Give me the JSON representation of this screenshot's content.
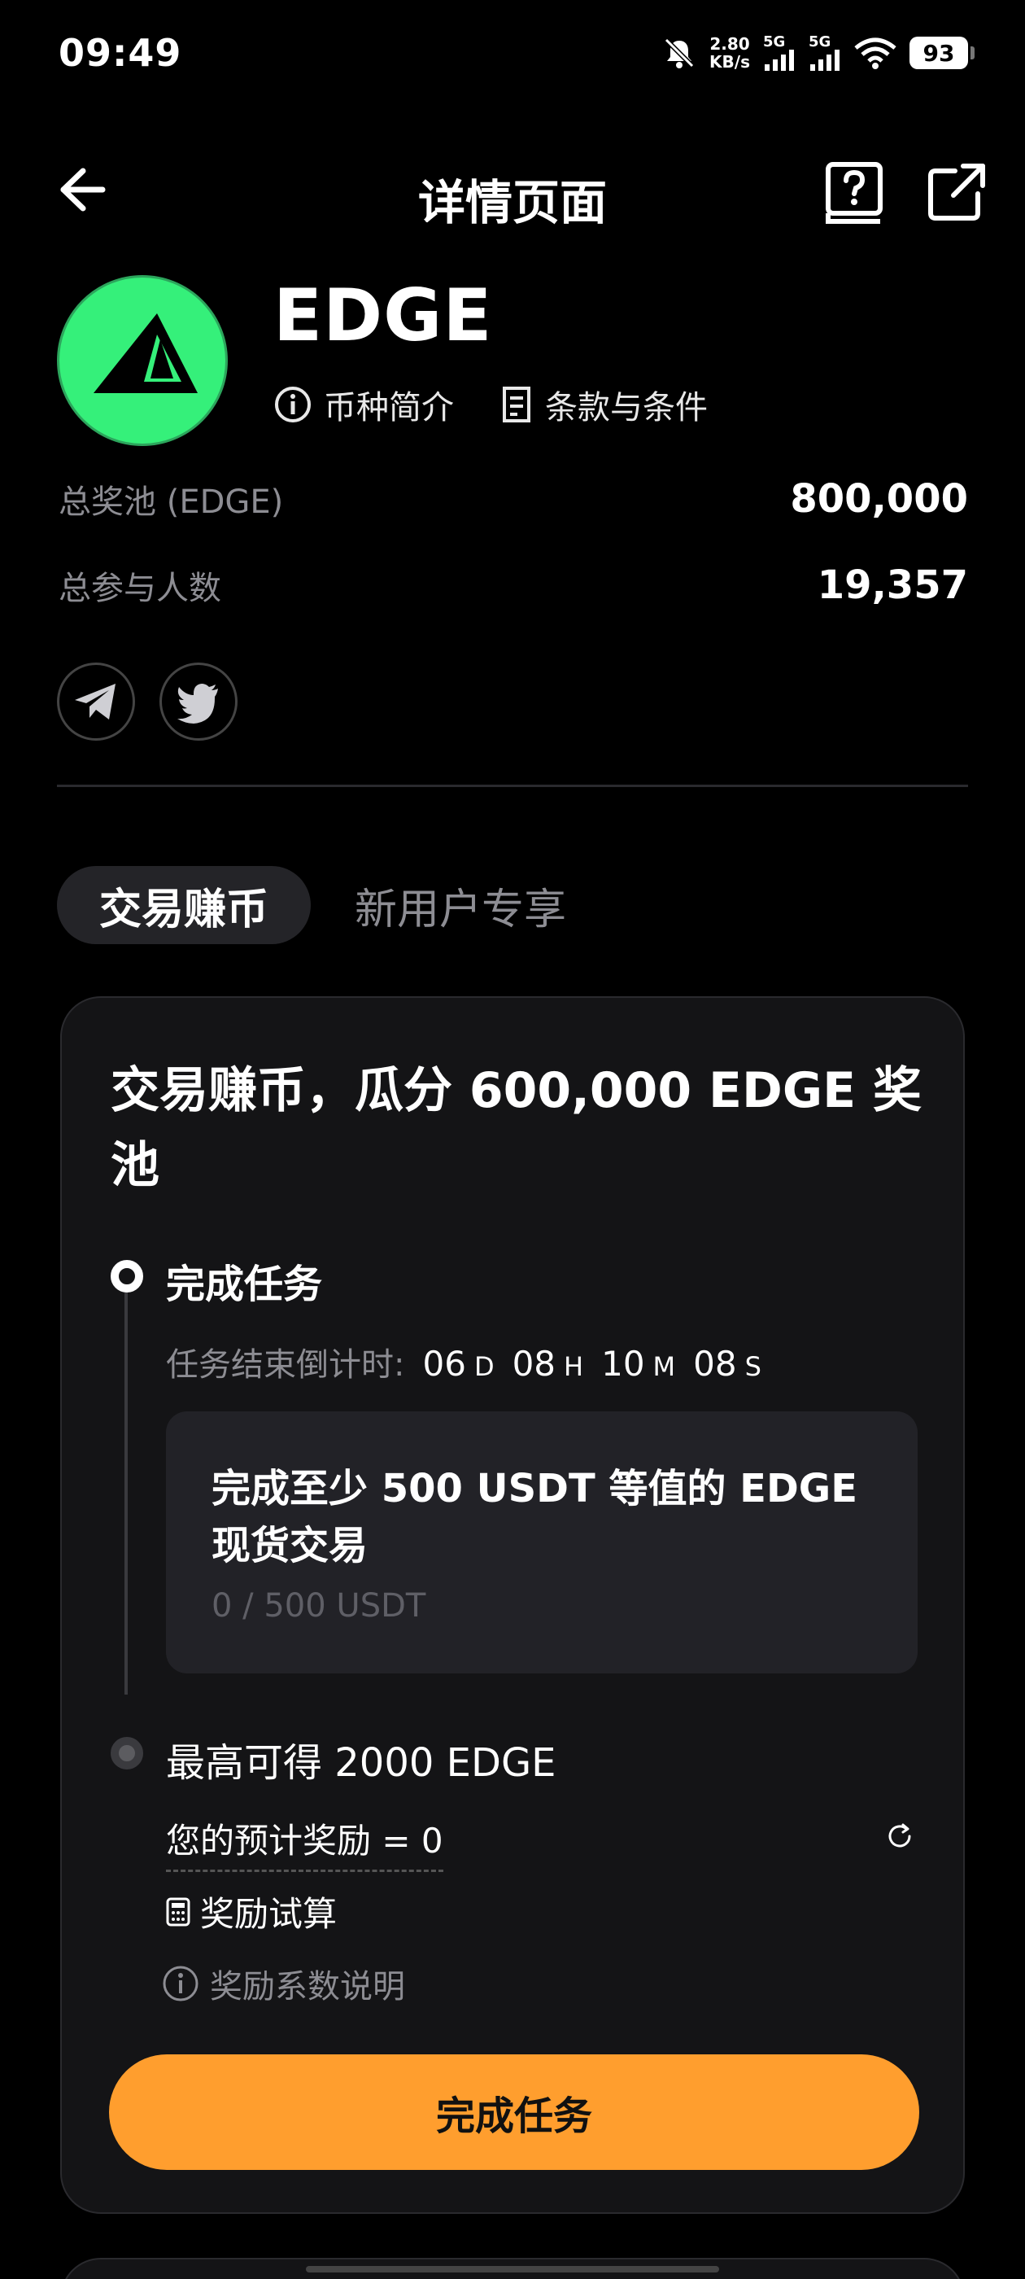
{
  "status_bar": {
    "time": "09:49",
    "net_speed_value": "2.80",
    "net_speed_unit": "KB/s",
    "sim1": "5G",
    "sim2": "5G",
    "battery": "93"
  },
  "nav": {
    "title": "详情页面",
    "back_icon": "arrow-left-icon",
    "help_icon": "help-book-icon",
    "share_icon": "external-link-icon"
  },
  "coin": {
    "name": "EDGE",
    "logo_color": "#35f07a",
    "link_intro": "币种简介",
    "link_terms": "条款与条件"
  },
  "stats": [
    {
      "label": "总奖池 (EDGE)",
      "value": "800,000"
    },
    {
      "label": "总参与人数",
      "value": "19,357"
    }
  ],
  "socials": [
    "telegram-icon",
    "twitter-icon"
  ],
  "tabs": {
    "active": "交易赚币",
    "inactive": "新用户专享"
  },
  "card": {
    "title": "交易赚币，瓜分 600,000 EDGE 奖池",
    "step1_title": "完成任务",
    "countdown_label": "任务结束倒计时:",
    "countdown": {
      "d": "06",
      "d_unit": "D",
      "h": "08",
      "h_unit": "H",
      "m": "10",
      "m_unit": "M",
      "s": "08",
      "s_unit": "S"
    },
    "task_text": "完成至少 500 USDT 等值的 EDGE 现货交易",
    "task_progress": "0 / 500 USDT",
    "step2_title": "最高可得 2000 EDGE",
    "estimate": "您的预计奖励 = 0",
    "calc_label": "奖励试算",
    "explain_label": "奖励系数说明",
    "cta_label": "完成任务",
    "cta_color": "#ff9e2e"
  }
}
